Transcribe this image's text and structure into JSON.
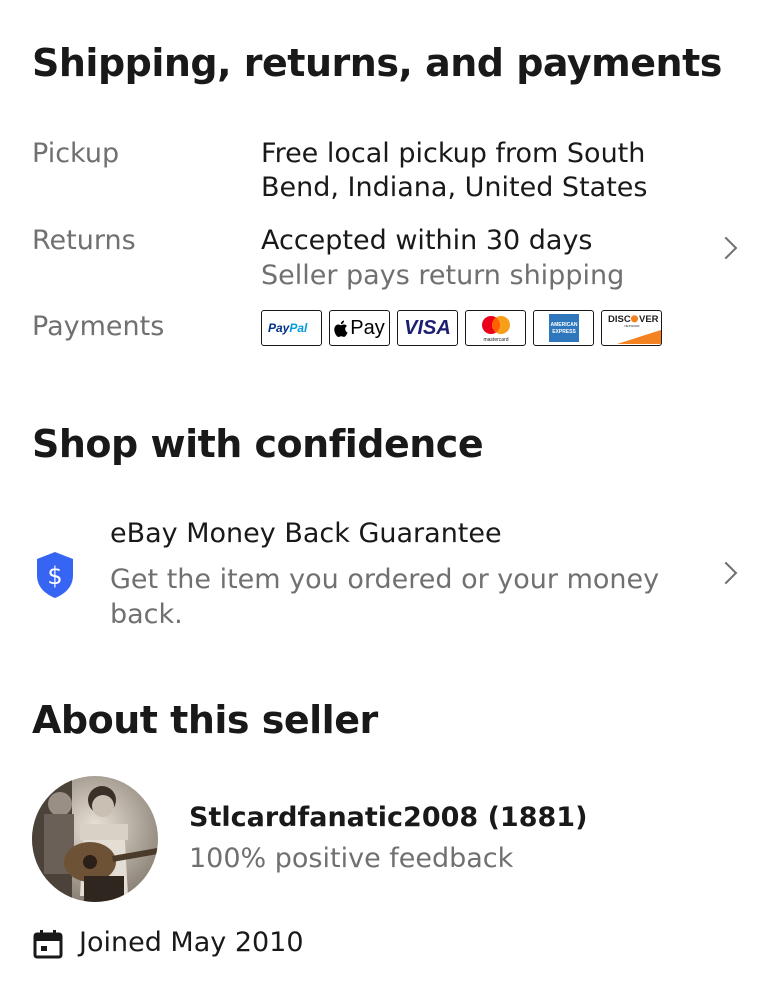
{
  "sections": {
    "shipping_title": "Shipping, returns, and payments",
    "confidence_title": "Shop with confidence",
    "seller_title": "About this seller"
  },
  "shipping": {
    "pickup_label": "Pickup",
    "pickup_value": "Free local pickup from South Bend, Indiana, United States",
    "returns_label": "Returns",
    "returns_value": "Accepted within 30 days",
    "returns_sub": "Seller pays return shipping",
    "payments_label": "Payments",
    "payment_methods": [
      {
        "name": "PayPal",
        "icon": "paypal-logo"
      },
      {
        "name": "Pay",
        "icon": "apple-pay-logo"
      },
      {
        "name": "VISA",
        "icon": "visa-logo"
      },
      {
        "name": "mastercard",
        "icon": "mastercard-logo"
      },
      {
        "name": "AMERICAN EXPRESS",
        "icon": "amex-logo"
      },
      {
        "name": "DISCOVER",
        "icon": "discover-logo"
      }
    ]
  },
  "guarantee": {
    "icon": "shield-dollar-icon",
    "title": "eBay Money Back Guarantee",
    "subtitle": "Get the item you ordered or your money back."
  },
  "seller": {
    "name": "Stlcardfanatic2008 (1881)",
    "feedback": "100% positive feedback",
    "joined": "Joined May 2010"
  },
  "colors": {
    "text": "#191919",
    "secondary": "#707070",
    "shield_blue": "#3665f3"
  }
}
